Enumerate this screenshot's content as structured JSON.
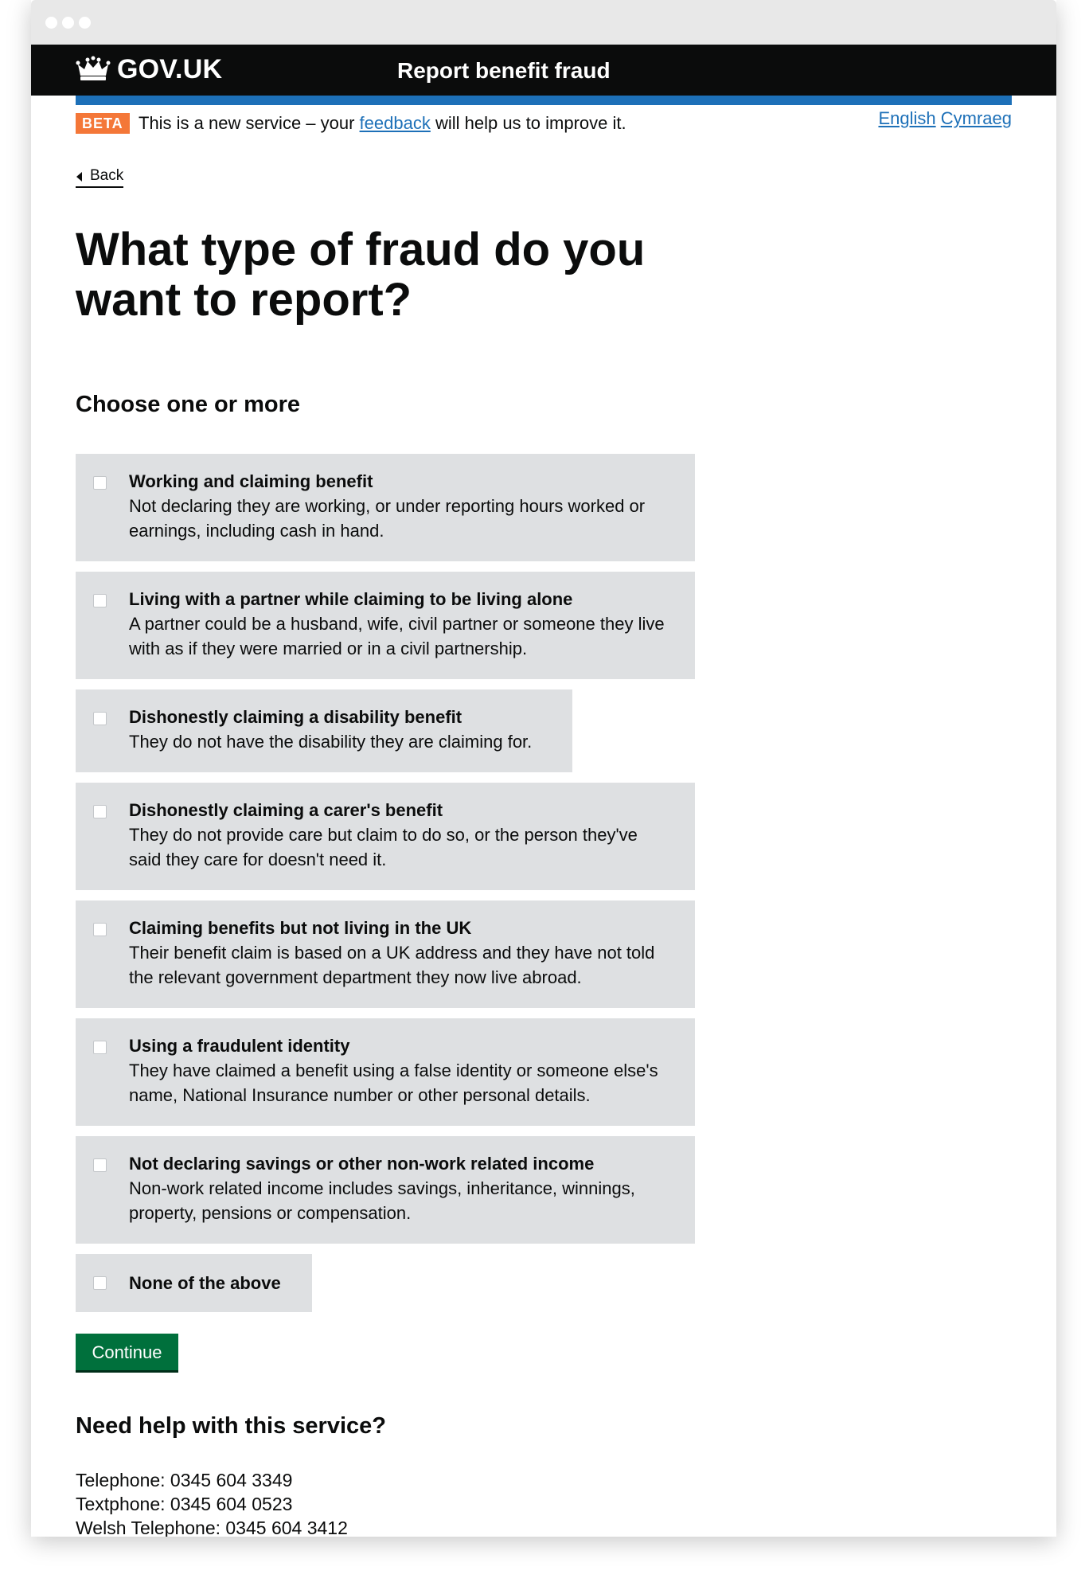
{
  "header": {
    "logo_text": "GOV.UK",
    "service_name": "Report benefit fraud"
  },
  "phase_banner": {
    "tag": "BETA",
    "text_before": "This is a new service – your ",
    "link": "feedback",
    "text_after": " will help us to improve it."
  },
  "language": {
    "english": "English",
    "welsh": "Cymraeg"
  },
  "back_link": "Back",
  "page_title": "What type of fraud do you want to report?",
  "legend": "Choose one or more",
  "options": [
    {
      "title": "Working and claiming benefit",
      "hint": "Not declaring they are working, or under reporting hours worked or earnings, including cash in hand.",
      "checked": false
    },
    {
      "title": "Living with a partner while claiming to be living alone",
      "hint": "A partner could be a husband, wife, civil partner or someone they live with as if they were married or in a civil partnership.",
      "checked": false
    },
    {
      "title": "Dishonestly claiming a disability benefit",
      "hint": "They do not have the disability they are claiming for.",
      "checked": false
    },
    {
      "title": "Dishonestly claiming a carer's benefit",
      "hint": "They do not provide care but claim to do so, or the person they've said they care for doesn't need it.",
      "checked": false
    },
    {
      "title": "Claiming benefits but not living in the UK",
      "hint": "Their benefit claim is based on a UK address and they have not told the relevant government department they now live abroad.",
      "checked": false
    },
    {
      "title": "Using a fraudulent identity",
      "hint": "They have claimed a benefit using a false identity or someone else's name, National Insurance number or other personal details.",
      "checked": false
    },
    {
      "title": "Not declaring savings or other non-work related income",
      "hint": "Non-work related income includes savings, inheritance, winnings, property, pensions or compensation.",
      "checked": false
    },
    {
      "title": "None of the above",
      "checked": false
    }
  ],
  "continue_button": "Continue",
  "help": {
    "title": "Need help with this service?",
    "telephone": "Telephone: 0345 604 3349",
    "textphone": "Textphone: 0345 604 0523",
    "welsh_telephone": "Welsh Telephone: 0345 604 3412"
  },
  "colors": {
    "header_bg": "#0b0c0c",
    "blue_bar": "#1d70b8",
    "beta_tag": "#f47738",
    "link": "#1d70b8",
    "option_bg": "#dee0e2",
    "button": "#00703c"
  }
}
